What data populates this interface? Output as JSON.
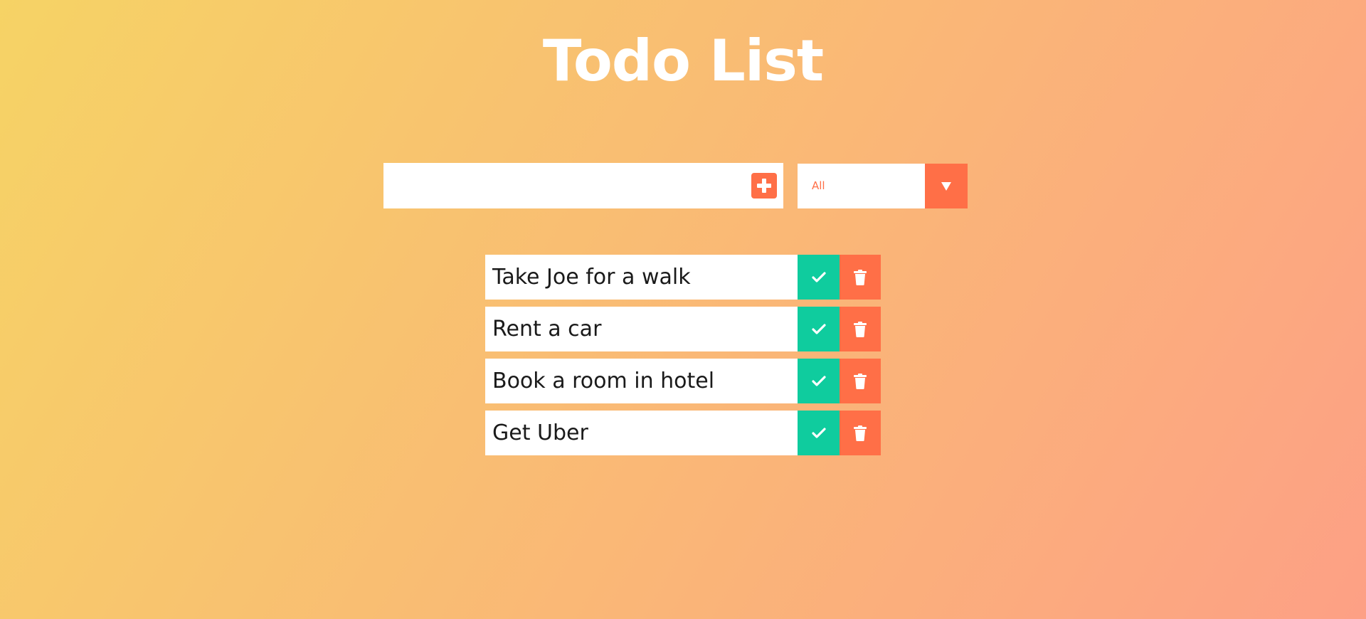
{
  "header": {
    "title": "Todo List"
  },
  "form": {
    "input_value": "",
    "input_placeholder": "",
    "add_icon": "plus-square-icon",
    "filter_selected": "All",
    "filter_arrow_icon": "caret-down-icon"
  },
  "todos": [
    {
      "text": "Take Joe for a walk"
    },
    {
      "text": "Rent a car"
    },
    {
      "text": "Book a room in hotel"
    },
    {
      "text": "Get Uber"
    }
  ],
  "icons": {
    "complete": "check-icon",
    "delete": "trash-icon"
  },
  "colors": {
    "gradient_start": "#f6d365",
    "gradient_end": "#fda085",
    "accent": "#ff6f47",
    "complete": "#0fcc9e",
    "title": "#ffffff"
  }
}
